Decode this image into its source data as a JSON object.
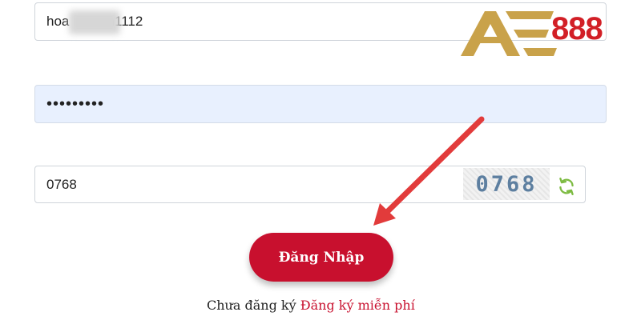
{
  "login_form": {
    "username_value": "hoa          n1112",
    "password_value": "•••••••••",
    "captcha_value": "0768",
    "captcha_image_text": "0768",
    "submit_label": "Đăng Nhập"
  },
  "register_prompt": {
    "text": "Chưa đăng ký",
    "link_label": "Đăng ký miễn phí"
  },
  "brand": {
    "logo_text": "888",
    "logo_letters": "AE",
    "colors": {
      "gold": "#c9a24a",
      "red": "#d21f26",
      "button": "#c8102e",
      "arrow": "#e23b3b"
    }
  },
  "icons": [
    "refresh-icon"
  ]
}
